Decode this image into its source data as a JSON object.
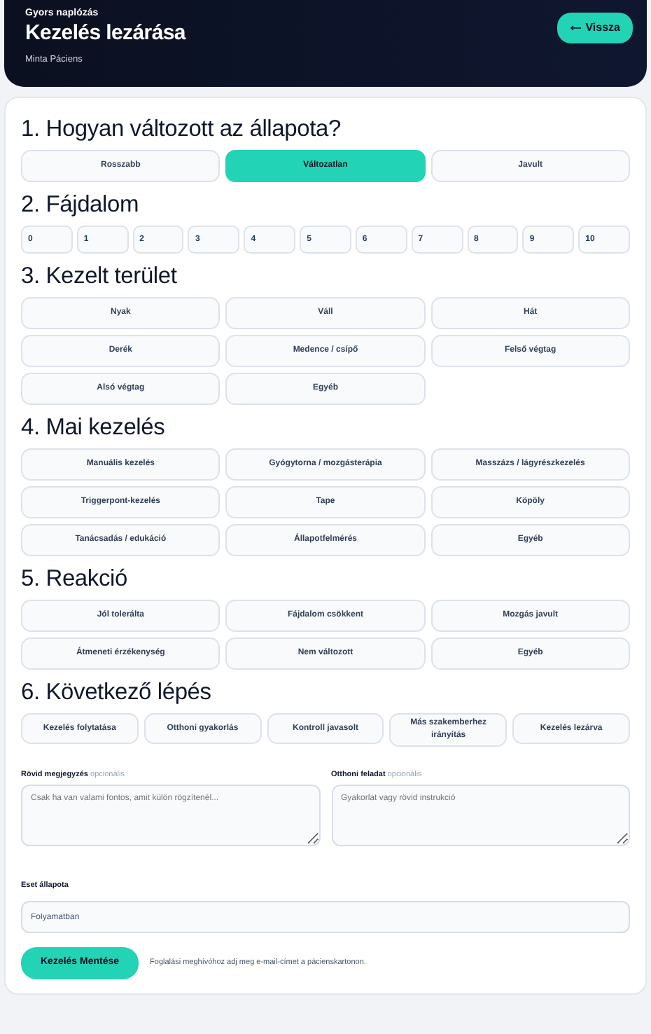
{
  "header": {
    "eyebrow": "Gyors naplózás",
    "title": "Kezelés lezárása",
    "patient": "Minta Páciens",
    "back_button": "Vissza"
  },
  "sections": [
    {
      "kind": "grid",
      "title": "1. Hogyan változott az állapota?",
      "options": [
        {
          "label": "Rosszabb",
          "selected": false
        },
        {
          "label": "Változatlan",
          "selected": true
        },
        {
          "label": "Javult",
          "selected": false
        }
      ]
    },
    {
      "kind": "scale",
      "title": "2. Fájdalom",
      "options": [
        {
          "label": "0",
          "selected": false
        },
        {
          "label": "1",
          "selected": false
        },
        {
          "label": "2",
          "selected": false
        },
        {
          "label": "3",
          "selected": false
        },
        {
          "label": "4",
          "selected": false
        },
        {
          "label": "5",
          "selected": false
        },
        {
          "label": "6",
          "selected": false
        },
        {
          "label": "7",
          "selected": false
        },
        {
          "label": "8",
          "selected": false
        },
        {
          "label": "9",
          "selected": false
        },
        {
          "label": "10",
          "selected": false
        }
      ]
    },
    {
      "kind": "grid",
      "title": "3. Kezelt terület",
      "options": [
        {
          "label": "Nyak",
          "selected": false
        },
        {
          "label": "Váll",
          "selected": false
        },
        {
          "label": "Hát",
          "selected": false
        },
        {
          "label": "Derék",
          "selected": false
        },
        {
          "label": "Medence / csípő",
          "selected": false
        },
        {
          "label": "Felső végtag",
          "selected": false
        },
        {
          "label": "Alsó végtag",
          "selected": false
        },
        {
          "label": "Egyéb",
          "selected": false
        }
      ]
    },
    {
      "kind": "grid",
      "title": "4. Mai kezelés",
      "options": [
        {
          "label": "Manuális kezelés",
          "selected": false
        },
        {
          "label": "Gyógytorna / mozgásterápia",
          "selected": false
        },
        {
          "label": "Masszázs / lágyrészkezelés",
          "selected": false
        },
        {
          "label": "Triggerpont-kezelés",
          "selected": false
        },
        {
          "label": "Tape",
          "selected": false
        },
        {
          "label": "Köpöly",
          "selected": false
        },
        {
          "label": "Tanácsadás / edukáció",
          "selected": false
        },
        {
          "label": "Állapotfelmérés",
          "selected": false
        },
        {
          "label": "Egyéb",
          "selected": false
        }
      ]
    },
    {
      "kind": "grid",
      "title": "5. Reakció",
      "options": [
        {
          "label": "Jól tolerálta",
          "selected": false
        },
        {
          "label": "Fájdalom csökkent",
          "selected": false
        },
        {
          "label": "Mozgás javult",
          "selected": false
        },
        {
          "label": "Átmeneti érzékenység",
          "selected": false
        },
        {
          "label": "Nem változott",
          "selected": false
        },
        {
          "label": "Egyéb",
          "selected": false
        }
      ]
    },
    {
      "kind": "row",
      "title": "6. Következő lépés",
      "options": [
        {
          "label": "Kezelés folytatása",
          "selected": false
        },
        {
          "label": "Otthoni gyakorlás",
          "selected": false
        },
        {
          "label": "Kontroll javasolt",
          "selected": false
        },
        {
          "label": "Más szakemberhez irányítás",
          "selected": false
        },
        {
          "label": "Kezelés lezárva",
          "selected": false
        }
      ]
    }
  ],
  "notes": [
    {
      "label": "Rövid megjegyzés",
      "hint": "opcionális",
      "placeholder": "Csak ha van valami fontos, amit külön rögzítenél..."
    },
    {
      "label": "Otthoni feladat",
      "hint": "opcionális",
      "placeholder": "Gyakorlat vagy rövid instrukció"
    }
  ],
  "case_status": {
    "label": "Eset állapota",
    "value": "Folyamatban"
  },
  "save_button": "Kezelés Mentése",
  "footer_note": "Foglalási meghívóhoz adj meg e-mail-címet a pácienskartonon."
}
